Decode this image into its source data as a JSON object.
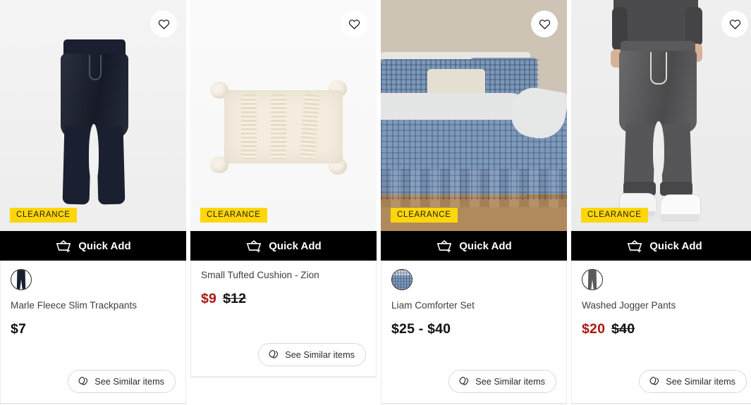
{
  "labels": {
    "quick_add": "Quick Add",
    "see_similar": "See Similar items",
    "clearance": "CLEARANCE"
  },
  "colors": {
    "badge_bg": "#FFD60A",
    "badge_text": "#1a1a1a",
    "quick_add_bg": "#000000",
    "quick_add_text": "#ffffff",
    "sale_price": "#AE1616",
    "regular_price": "#111111",
    "title_text": "#3f3f3f"
  },
  "icons": {
    "wishlist": "heart-icon",
    "quick_add": "basket-plus-icon",
    "see_similar": "similar-items-icon"
  },
  "products": [
    {
      "title": "Marle Fleece Slim Trackpants",
      "badge": "CLEARANCE",
      "quick_add": "Quick Add",
      "see_similar": "See Similar items",
      "price": "$7",
      "was_price": "",
      "on_sale": false,
      "has_swatch": true,
      "swatch_name": "navy-trackpants-swatch",
      "image_alt": "navy fleece trackpants on light grey background"
    },
    {
      "title": "Small Tufted Cushion - Zion",
      "badge": "CLEARANCE",
      "quick_add": "Quick Add",
      "see_similar": "See Similar items",
      "price": "$9",
      "was_price": "$12",
      "on_sale": true,
      "has_swatch": false,
      "swatch_name": "",
      "image_alt": "cream tufted cushion with pom pom corners"
    },
    {
      "title": "Liam Comforter Set",
      "badge": "CLEARANCE",
      "quick_add": "Quick Add",
      "see_similar": "See Similar items",
      "price": "$25 - $40",
      "was_price": "",
      "on_sale": false,
      "has_swatch": true,
      "swatch_name": "blue-comforter-swatch",
      "image_alt": "blue patterned comforter set on bed with nightstand"
    },
    {
      "title": "Washed Jogger Pants",
      "badge": "CLEARANCE",
      "quick_add": "Quick Add",
      "see_similar": "See Similar items",
      "price": "$20",
      "was_price": "$40",
      "on_sale": true,
      "has_swatch": true,
      "swatch_name": "grey-jogger-swatch",
      "image_alt": "model wearing dark grey washed jogger pants with white sneakers"
    }
  ]
}
